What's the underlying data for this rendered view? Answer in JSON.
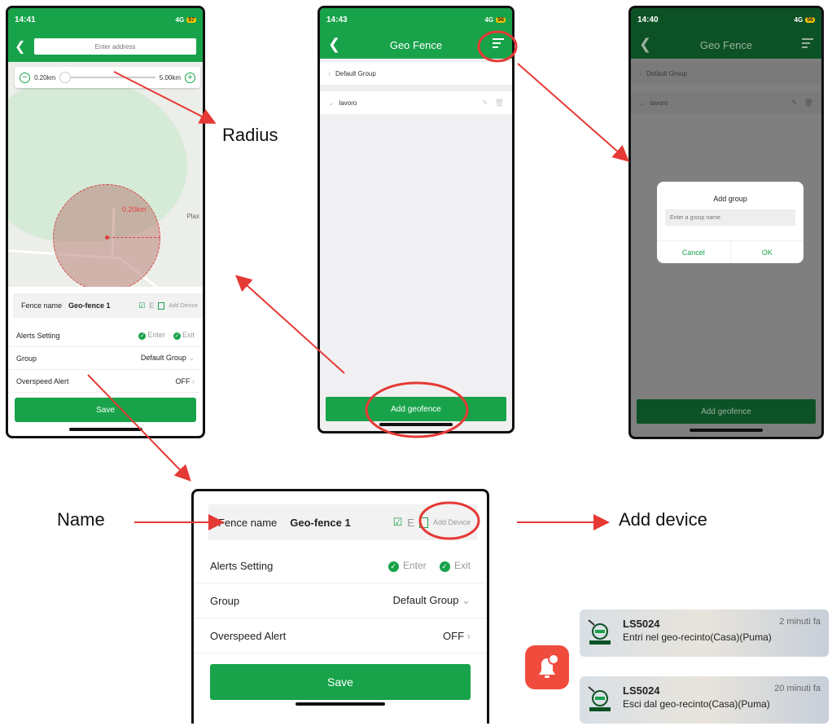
{
  "phone1": {
    "status": {
      "time": "14:41",
      "signal": "4G",
      "battery": "57"
    },
    "address_placeholder": "Enter address",
    "radius_min": "0.20km",
    "radius_max": "5.00km",
    "radius_current": "0.20km",
    "map_place": "Plax",
    "fence_name_label": "Fence name",
    "fence_name_value": "Geo-fence 1",
    "edit_letter": "E",
    "add_device": "Add Device",
    "alerts_label": "Alerts Setting",
    "enter_label": "Enter",
    "exit_label": "Exit",
    "group_label": "Group",
    "group_value": "Default Group",
    "overspeed_label": "Overspeed Alert",
    "overspeed_value": "OFF",
    "save": "Save"
  },
  "phone2": {
    "status": {
      "time": "14:43",
      "signal": "4G",
      "battery": "56"
    },
    "title": "Geo Fence",
    "groups": [
      "Default Group",
      "lavoro"
    ],
    "add_geofence": "Add geofence"
  },
  "phone3": {
    "status": {
      "time": "14:40",
      "signal": "4G",
      "battery": "56"
    },
    "title": "Geo Fence",
    "groups": [
      "Default Group",
      "lavoro"
    ],
    "dialog_title": "Add group",
    "dialog_placeholder": "Enter a group name",
    "cancel": "Cancel",
    "ok": "OK",
    "add_geofence": "Add geofence"
  },
  "zoom": {
    "fence_name_label": "Fence name",
    "fence_name_value": "Geo-fence 1",
    "edit_letter": "E",
    "add_device": "Add Device",
    "alerts_label": "Alerts Setting",
    "enter_label": "Enter",
    "exit_label": "Exit",
    "group_label": "Group",
    "group_value": "Default Group",
    "overspeed_label": "Overspeed Alert",
    "overspeed_value": "OFF",
    "save": "Save"
  },
  "annotations": {
    "radius": "Radius",
    "name": "Name",
    "add_device": "Add device"
  },
  "notifications": [
    {
      "title": "LS5024",
      "time": "2 minuti fa",
      "message": "Entri nel geo-recinto(Casa)(Puma)"
    },
    {
      "title": "LS5024",
      "time": "20 minuti fa",
      "message": "Esci dal geo-recinto(Casa)(Puma)"
    }
  ],
  "colors": {
    "accent": "#18a34a",
    "annotation_red": "#e53935",
    "dim_green": "#0d5226"
  }
}
